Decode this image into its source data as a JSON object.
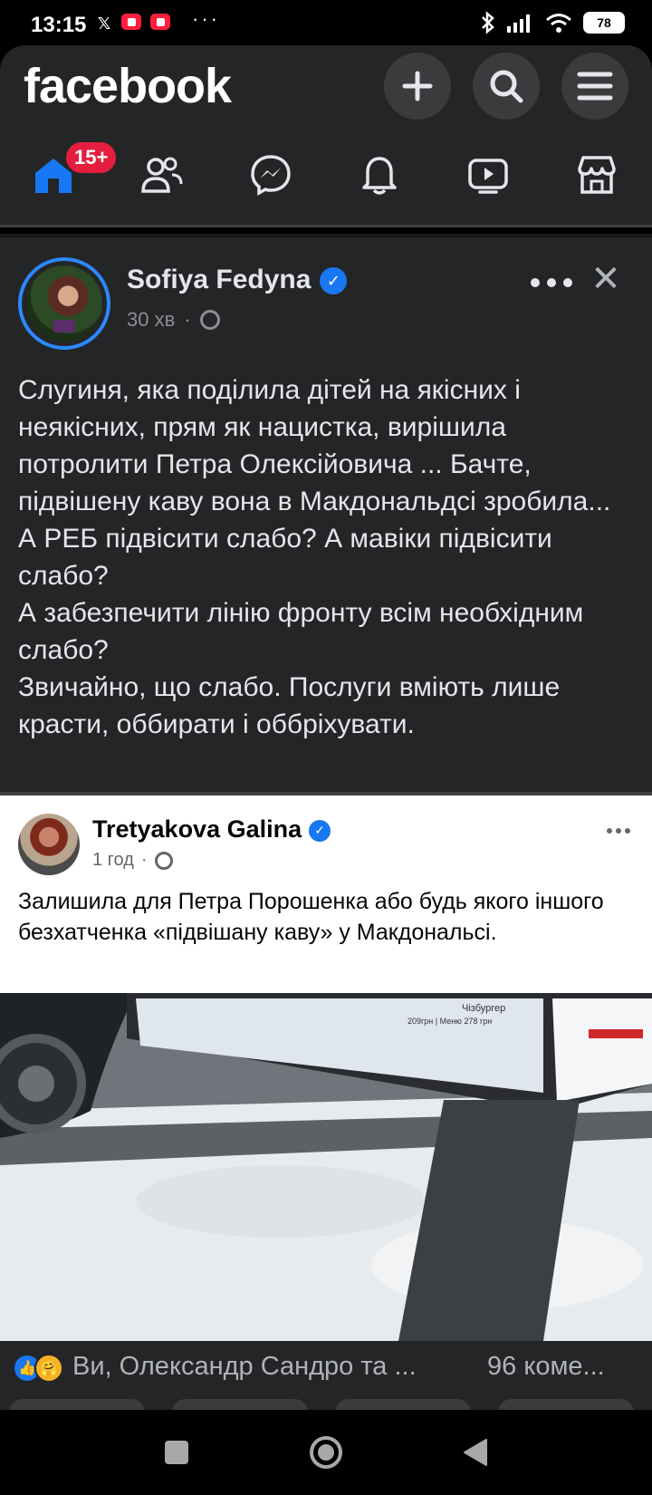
{
  "status_bar": {
    "time": "13:15",
    "x_notification": "𝕏",
    "more_indicator": "···",
    "battery": "78"
  },
  "header": {
    "logo": "facebook",
    "badge_count": "15+",
    "icons": [
      "plus-icon",
      "search-icon",
      "menu-icon"
    ],
    "tabs": [
      "home",
      "friends",
      "messenger",
      "notifications",
      "video",
      "marketplace"
    ]
  },
  "post1": {
    "author": "Sofiya Fedyna",
    "verified": true,
    "time": "30 хв",
    "separator": "·",
    "text": "Слугиня, яка поділила дітей на якісних і неякісних, прям як нацистка, вирішила потролити Петра Олексійовича ... Бачте, підвішену каву вона в Макдональдсі зробила...\nА РЕБ підвісити слабо? А мавіки підвісити слабо?\nА забезпечити лінію фронту всім необхідним слабо?\nЗвичайно, що слабо. Послуги вміють лише красти, оббирати і оббріхувати."
  },
  "post2": {
    "author": "Tretyakova  Galina",
    "verified": true,
    "time": "1 год",
    "separator": "·",
    "text": "Залишила для Петра Порошенка або будь якого іншого безхатченка «підвішану каву» у Макдональсі.",
    "sign_text": "Чізбургер",
    "sign_price": "209грн | Меню 278 грн"
  },
  "reactions": {
    "names": "Ви, Олександр Сандро та ...",
    "comments": "96 коме..."
  },
  "colors": {
    "brand": "#1877f2",
    "badge": "#e41e3f",
    "dark_surface": "#242526"
  }
}
